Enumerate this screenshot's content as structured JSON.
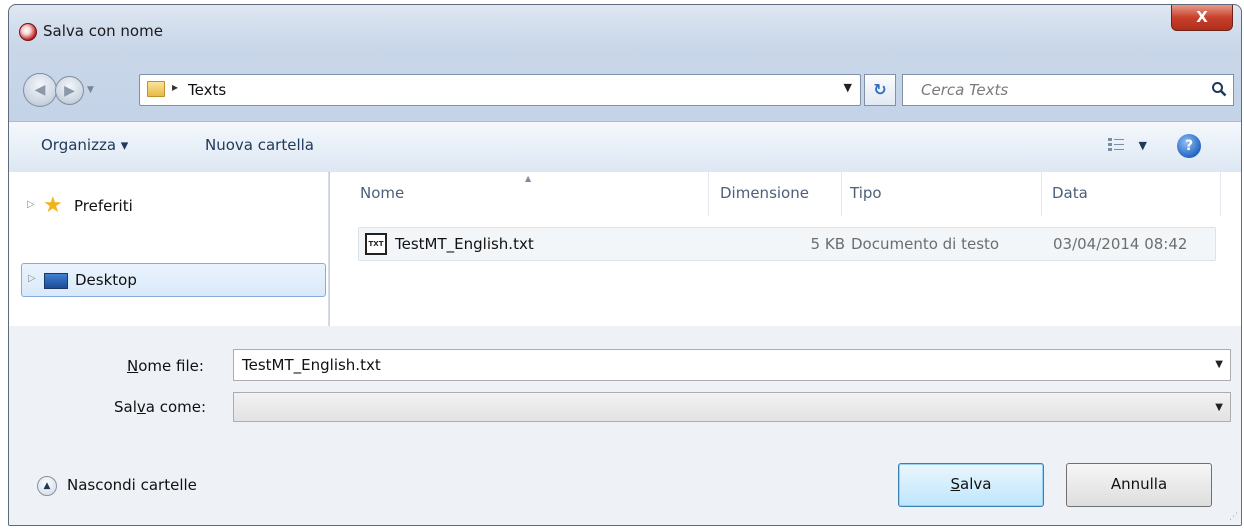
{
  "window": {
    "title": "Salva con nome",
    "close_glyph": "X"
  },
  "nav": {
    "back_glyph": "◀",
    "forward_glyph": "▶",
    "history_glyph": "▼",
    "breadcrumb": "Texts",
    "breadcrumb_arrow": "▸",
    "address_dropdown_glyph": "▼",
    "refresh_glyph": "↻",
    "search_placeholder": "Cerca Texts"
  },
  "toolbar": {
    "organize_label": "Organizza ▾",
    "new_folder_label": "Nuova cartella",
    "view_dropdown_glyph": "▼",
    "help_glyph": "?"
  },
  "tree": {
    "items": [
      {
        "label": "Preferiti",
        "icon": "star-icon",
        "selected": false
      },
      {
        "label": "Desktop",
        "icon": "desktop-icon",
        "selected": true
      }
    ],
    "expander_glyph": "▷"
  },
  "file_list": {
    "columns": [
      "Nome",
      "Dimensione",
      "Tipo",
      "Data"
    ],
    "sort_glyph": "▲",
    "rows": [
      {
        "name": "TestMT_English.txt",
        "icon_label": "TXT",
        "size": "5 KB",
        "type": "Documento di testo",
        "date": "03/04/2014 08:42"
      }
    ]
  },
  "form": {
    "filename_label_pre": "N",
    "filename_label_rest": "ome file:",
    "filename_value": "TestMT_English.txt",
    "savetype_label_pre": "Sal",
    "savetype_label_ul": "v",
    "savetype_label_rest": "a come:",
    "savetype_value": "",
    "dropdown_glyph": "▼"
  },
  "footer": {
    "hide_folders_label": "Nascondi cartelle",
    "toggle_glyph": "▲",
    "save_ul": "S",
    "save_rest": "alva",
    "cancel_label": "Annulla"
  },
  "colors": {
    "accent": "#3c7fb1",
    "link_text": "#1e395b",
    "window_frame": "#c4d3e7"
  }
}
